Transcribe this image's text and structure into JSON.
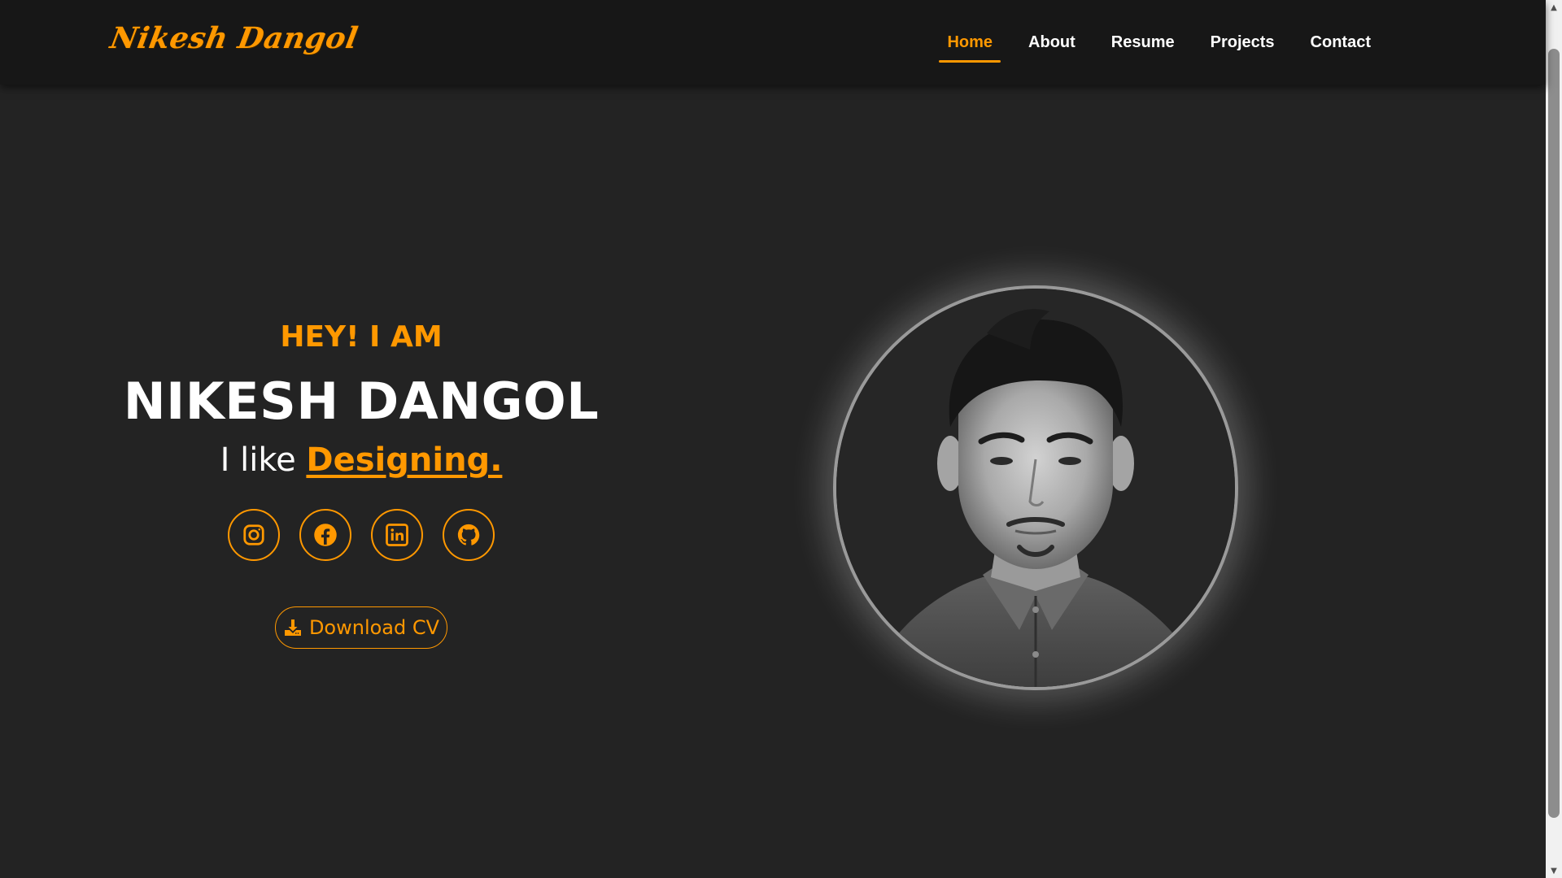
{
  "header": {
    "logo_text": "Nikesh Dangol",
    "nav": [
      {
        "label": "Home",
        "active": true
      },
      {
        "label": "About",
        "active": false
      },
      {
        "label": "Resume",
        "active": false
      },
      {
        "label": "Projects",
        "active": false
      },
      {
        "label": "Contact",
        "active": false
      }
    ]
  },
  "hero": {
    "greeting": "HEY! I AM",
    "name": "NIKESH DANGOL",
    "tagline_prefix": "I like ",
    "tagline_highlight": "Designing.",
    "socials": [
      {
        "icon": "instagram-icon"
      },
      {
        "icon": "facebook-icon"
      },
      {
        "icon": "linkedin-icon"
      },
      {
        "icon": "github-icon"
      }
    ],
    "download_label": "Download CV",
    "download_icon": "download-icon"
  },
  "portrait": {
    "icon": "profile-photo"
  },
  "colors": {
    "accent": "#ff9800",
    "background": "#232323",
    "header_bg": "#171717",
    "text": "#ffffff"
  }
}
